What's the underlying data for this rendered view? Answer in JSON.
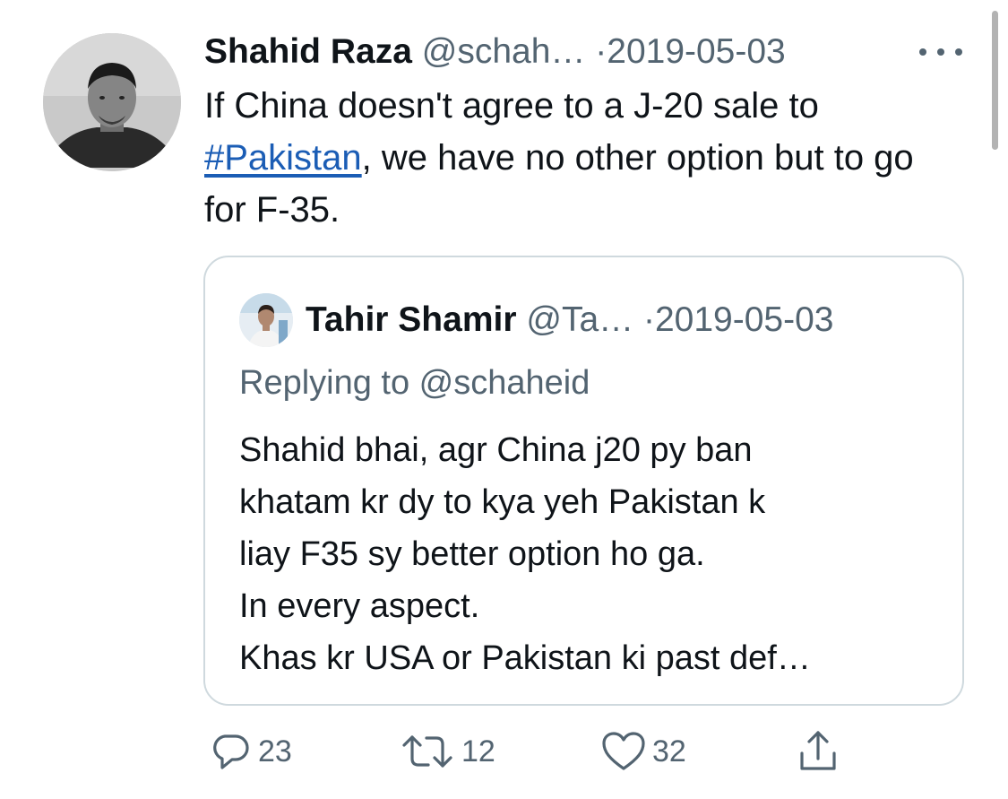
{
  "tweet": {
    "author_name": "Shahid Raza",
    "author_handle": "@schah…",
    "separator": "·",
    "date": "2019-05-03",
    "text_before": "If China doesn't agree to a J-20 sale to",
    "hashtag": "#Pakistan",
    "text_after": ", we have no other option but to go for F-35."
  },
  "quoted_tweet": {
    "author_name": "Tahir Shamir",
    "author_handle": "@Ta…",
    "separator": "·",
    "date": "2019-05-03",
    "replying_to": "Replying to @schaheid",
    "lines": [
      "Shahid bhai, agr China j20 py ban",
      "khatam kr dy to kya yeh Pakistan k",
      "liay F35 sy better option ho ga.",
      "In every aspect.",
      "Khas kr USA or Pakistan ki past def…"
    ]
  },
  "actions": {
    "replies": "23",
    "retweets": "12",
    "likes": "32"
  },
  "icons": {
    "more": "more-horizontal-icon",
    "reply": "reply-icon",
    "retweet": "retweet-icon",
    "like": "heart-icon",
    "share": "share-icon"
  },
  "colors": {
    "text": "#0f1419",
    "secondary": "#536471",
    "link": "#1b5db5",
    "border": "#cfd9de"
  }
}
